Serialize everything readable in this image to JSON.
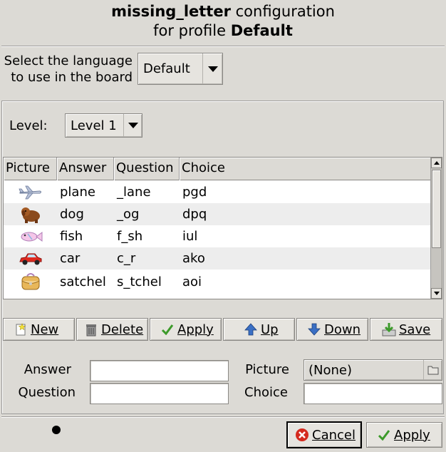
{
  "dialog": {
    "title_line1_bold": "missing_letter",
    "title_line1_rest": " configuration",
    "title_line2_rest": "for profile ",
    "title_line2_bold": "Default"
  },
  "language": {
    "label_line1": "Select the language",
    "label_line2": "to use in the board",
    "selected": "Default"
  },
  "level": {
    "label": "Level:",
    "selected": "Level 1"
  },
  "table": {
    "columns": [
      "Picture",
      "Answer",
      "Question",
      "Choice"
    ],
    "rows": [
      {
        "picture": "plane-icon",
        "answer": "plane",
        "question": "_lane",
        "choice": "pgd"
      },
      {
        "picture": "dog-icon",
        "answer": "dog",
        "question": "_og",
        "choice": "dpq"
      },
      {
        "picture": "fish-icon",
        "answer": "fish",
        "question": "f_sh",
        "choice": "iul"
      },
      {
        "picture": "car-icon",
        "answer": "car",
        "question": "c_r",
        "choice": "ako"
      },
      {
        "picture": "satchel-icon",
        "answer": "satchel",
        "question": "s_tchel",
        "choice": "aoi"
      }
    ]
  },
  "toolbar": {
    "new": "New",
    "delete": "Delete",
    "apply": "Apply",
    "up": "Up",
    "down": "Down",
    "save": "Save"
  },
  "form": {
    "answer_label": "Answer",
    "question_label": "Question",
    "picture_label": "Picture",
    "choice_label": "Choice",
    "answer_value": "",
    "question_value": "",
    "picture_value": "(None)",
    "choice_value": ""
  },
  "footer": {
    "cancel": "Cancel",
    "apply": "Apply"
  },
  "colors": {
    "background": "#dcdad5",
    "row_alt": "#ededed",
    "cancel_red": "#d42a1e",
    "apply_green": "#3c9a2a",
    "arrow_blue": "#3a6fc4"
  }
}
